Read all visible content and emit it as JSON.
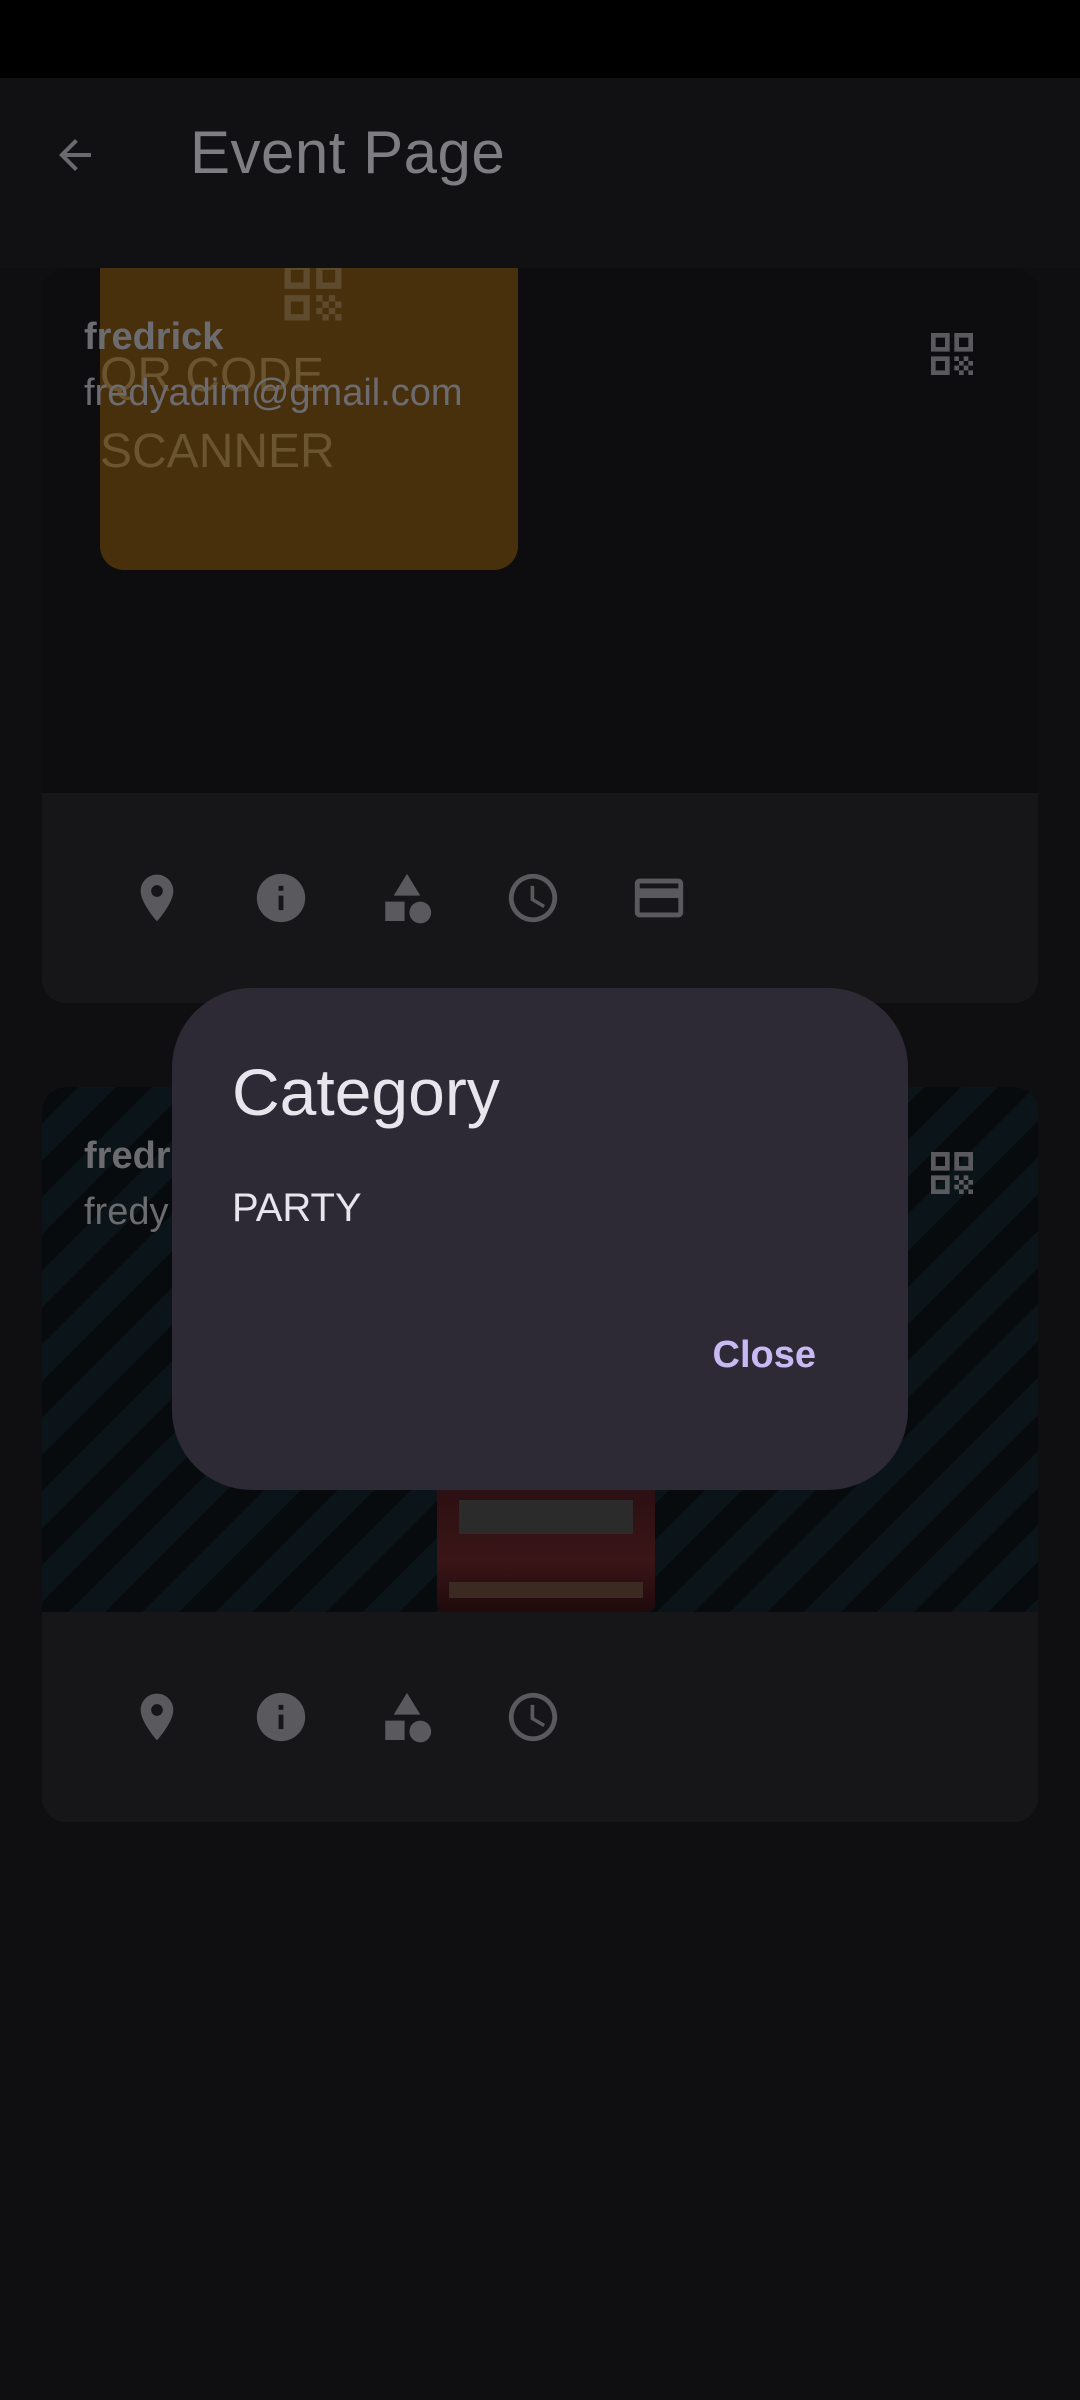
{
  "app_bar": {
    "title": "Event Page"
  },
  "icons": {
    "back": "arrow-back-icon",
    "qr": "qr-code-icon",
    "location": "location-pin-icon",
    "info": "info-icon",
    "category": "category-shapes-icon",
    "time": "clock-icon",
    "payment": "credit-card-icon"
  },
  "cards": [
    {
      "owner_name": "fredrick",
      "owner_email": "fredyadim@gmail.com",
      "banner_text_line1": "QR CODE",
      "banner_text_line2": "SCANNER"
    },
    {
      "owner_name": "fredr",
      "owner_email": "fredy"
    }
  ],
  "dialog": {
    "title": "Category",
    "body": "PARTY",
    "close_label": "Close"
  },
  "colors": {
    "background": "#0f0f11",
    "dialog_surface": "#2d2a36",
    "accent": "#c8b8f4",
    "banner": "#48300c"
  }
}
